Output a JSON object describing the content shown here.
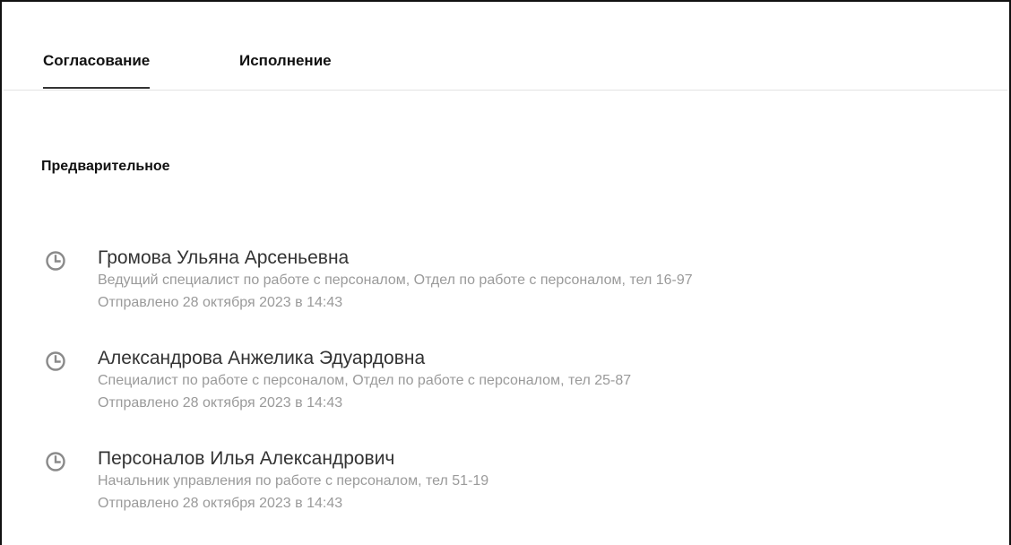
{
  "tabs": [
    {
      "label": "Согласование",
      "active": true
    },
    {
      "label": "Исполнение",
      "active": false
    }
  ],
  "section": {
    "title": "Предварительное"
  },
  "status_icon": "clock-icon",
  "colors": {
    "text": "#333333",
    "muted": "#9a9a9a",
    "icon": "#8a8a8a",
    "tab_underline": "#333333"
  },
  "approvers": [
    {
      "name": "Громова Ульяна Арсеньевна",
      "role": "Ведущий специалист по работе с персоналом, Отдел по работе с персоналом, тел 16-97",
      "sent": "Отправлено 28 октября 2023 в 14:43"
    },
    {
      "name": "Александрова Анжелика Эдуардовна",
      "role": "Специалист по работе с персоналом, Отдел по работе с персоналом, тел 25-87",
      "sent": "Отправлено 28 октября 2023 в 14:43"
    },
    {
      "name": "Персоналов Илья Александрович",
      "role": "Начальник управления по работе с персоналом, тел 51-19",
      "sent": "Отправлено 28 октября 2023 в 14:43"
    }
  ]
}
